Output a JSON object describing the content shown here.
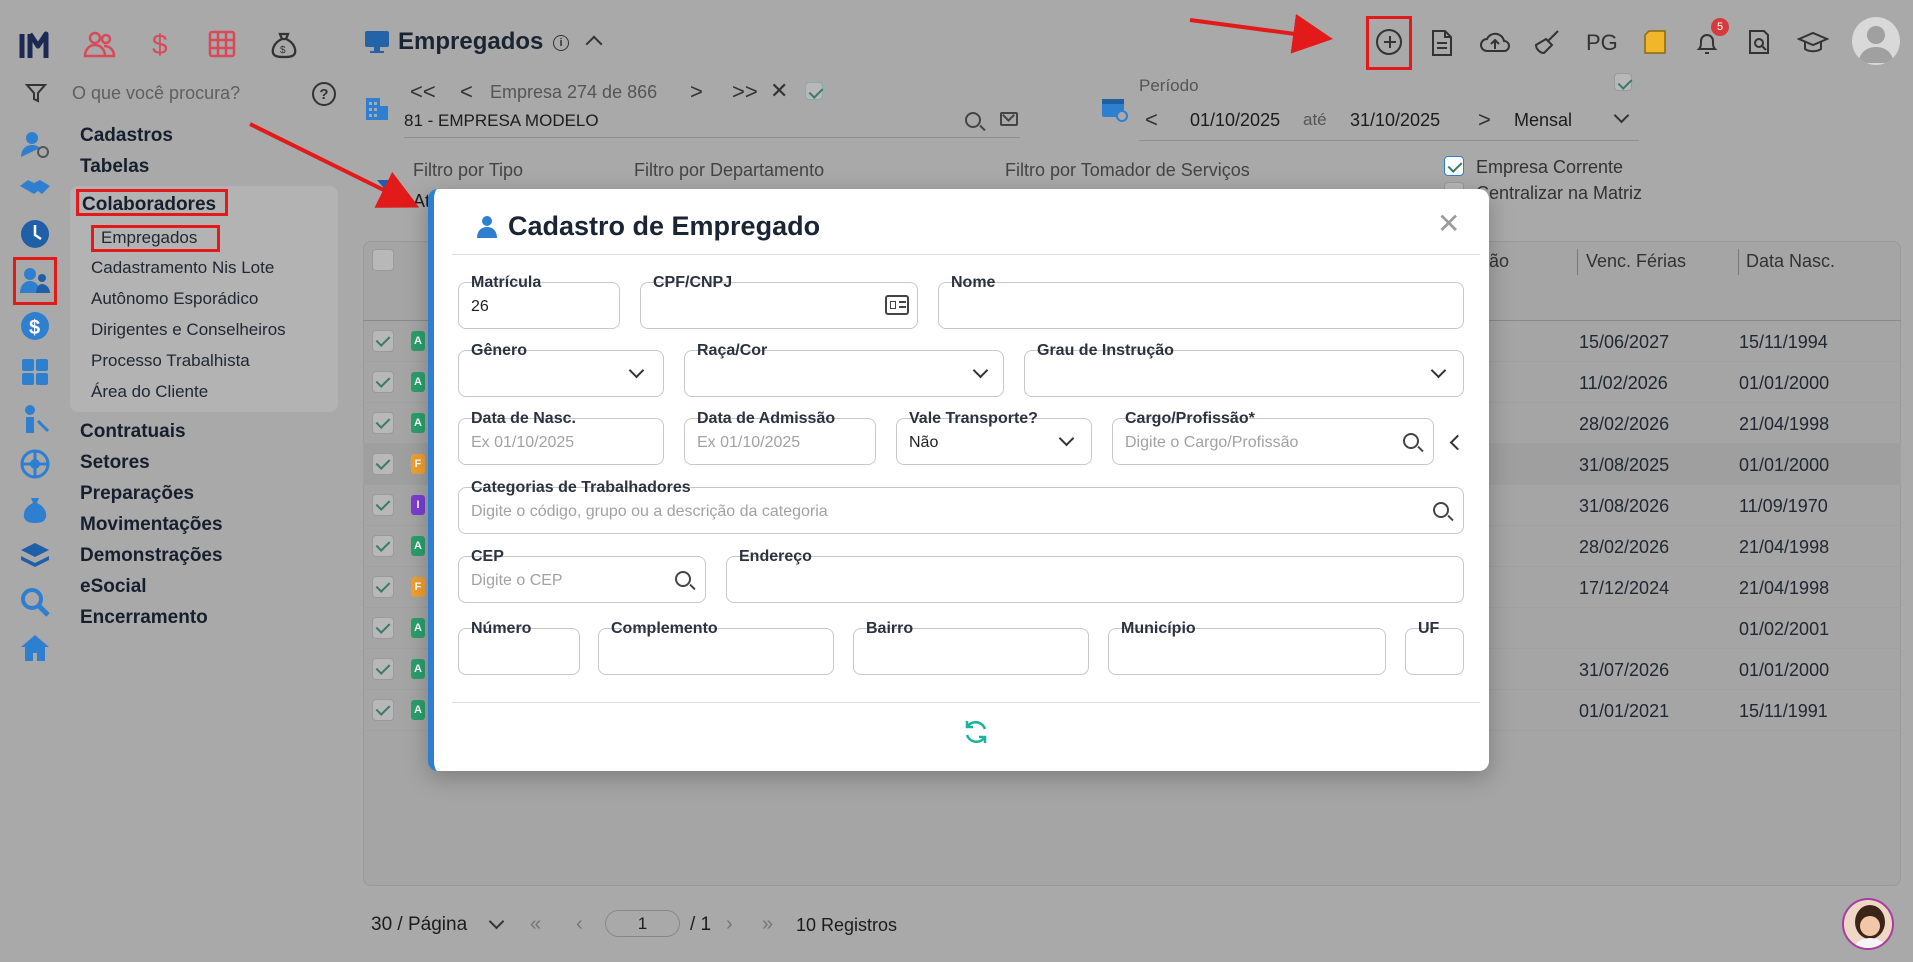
{
  "header": {
    "title": "Empregados",
    "company_nav": "Empresa 274 de 866",
    "company_name": "81 - EMPRESA MODELO",
    "period_label": "Período",
    "period_start": "01/10/2025",
    "period_sep": "até",
    "period_end": "31/10/2025",
    "period_mode": "Mensal",
    "pg_label": "PG",
    "notif_count": "5"
  },
  "sidebar": {
    "search_placeholder": "O que você procura?",
    "menu": {
      "cadastros": "Cadastros",
      "tabelas": "Tabelas",
      "colaboradores": "Colaboradores",
      "sub": [
        "Empregados",
        "Cadastramento Nis Lote",
        "Autônomo Esporádico",
        "Dirigentes e Conselheiros",
        "Processo Trabalhista",
        "Área do Cliente"
      ],
      "rest": [
        "Contratuais",
        "Setores",
        "Preparações",
        "Movimentações",
        "Demonstrações",
        "eSocial",
        "Encerramento"
      ]
    }
  },
  "filters": {
    "tipo": "Filtro por Tipo",
    "departamento": "Filtro por Departamento",
    "tomador": "Filtro por Tomador de Serviços",
    "empresa_corrente": "Empresa Corrente",
    "centralizar": "Centralizar na Matriz",
    "tipo_value_partial": "At"
  },
  "table": {
    "col_partial": "ão",
    "col_ferias": "Venc. Férias",
    "col_nasc": "Data Nasc.",
    "rows": [
      {
        "badge": "A",
        "ferias": "15/06/2027",
        "nasc": "15/11/1994"
      },
      {
        "badge": "A",
        "ferias": "11/02/2026",
        "nasc": "01/01/2000"
      },
      {
        "badge": "A",
        "ferias": "28/02/2026",
        "nasc": "21/04/1998"
      },
      {
        "badge": "F",
        "ferias": "31/08/2025",
        "nasc": "01/01/2000"
      },
      {
        "badge": "I",
        "ferias": "31/08/2026",
        "nasc": "11/09/1970"
      },
      {
        "badge": "A",
        "ferias": "28/02/2026",
        "nasc": "21/04/1998"
      },
      {
        "badge": "F",
        "ferias": "17/12/2024",
        "nasc": "21/04/1998"
      },
      {
        "badge": "A",
        "ferias": "",
        "nasc": "01/02/2001"
      },
      {
        "badge": "A",
        "ferias": "31/07/2026",
        "nasc": "01/01/2000"
      },
      {
        "badge": "A",
        "ferias": "01/01/2021",
        "nasc": "15/11/1991"
      }
    ]
  },
  "pagination": {
    "per_page": "30 / Página",
    "page": "1",
    "total_pages": "/ 1",
    "records": "10 Registros"
  },
  "modal": {
    "title": "Cadastro de Empregado",
    "matricula_label": "Matrícula",
    "matricula_value": "26",
    "cpf_label": "CPF/CNPJ",
    "nome_label": "Nome",
    "genero_label": "Gênero",
    "raca_label": "Raça/Cor",
    "grau_label": "Grau de Instrução",
    "nasc_label": "Data de Nasc.",
    "nasc_placeholder": "Ex 01/10/2025",
    "admissao_label": "Data de Admissão",
    "admissao_placeholder": "Ex 01/10/2025",
    "vale_label": "Vale Transporte?",
    "vale_value": "Não",
    "cargo_label": "Cargo/Profissão*",
    "cargo_placeholder": "Digite o Cargo/Profissão",
    "categorias_label": "Categorias de Trabalhadores",
    "categorias_placeholder": "Digite o código, grupo ou a descrição da categoria",
    "cep_label": "CEP",
    "cep_placeholder": "Digite o CEP",
    "endereco_label": "Endereço",
    "numero_label": "Número",
    "complemento_label": "Complemento",
    "bairro_label": "Bairro",
    "municipio_label": "Município",
    "uf_label": "UF"
  },
  "colors": {
    "accent": "#2f7fd1",
    "annotation": "#e21a1a",
    "brand": "#1b2a55",
    "pink": "#d84a5a",
    "teal": "#19b39b"
  }
}
